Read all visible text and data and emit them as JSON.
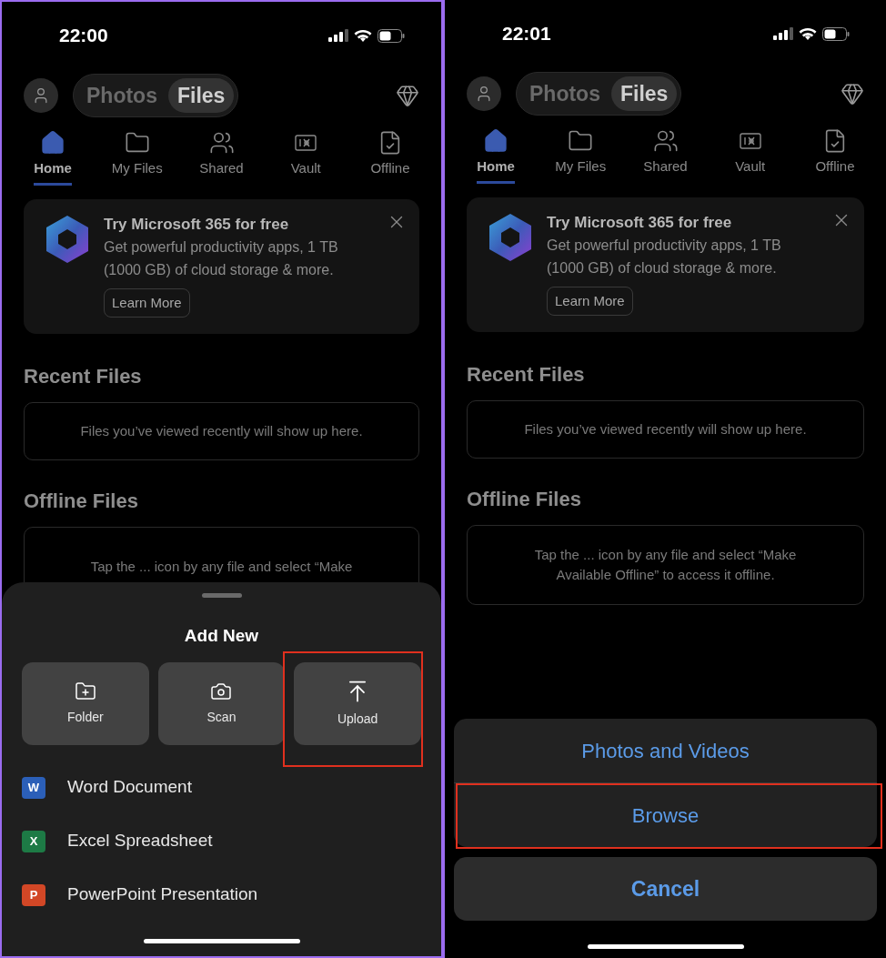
{
  "screens": [
    {
      "framed": true,
      "status_bar": {
        "time": "22:00"
      },
      "segments": [
        {
          "label": "Photos",
          "selected": false
        },
        {
          "label": "Files",
          "selected": true
        }
      ],
      "tabs": [
        {
          "label": "Home",
          "kind": "home",
          "selected": true
        },
        {
          "label": "My Files",
          "kind": "folder",
          "selected": false
        },
        {
          "label": "Shared",
          "kind": "shared",
          "selected": false
        },
        {
          "label": "Vault",
          "kind": "vault",
          "selected": false
        },
        {
          "label": "Offline",
          "kind": "offline",
          "selected": false
        }
      ],
      "promo": {
        "title": "Try Microsoft 365 for free",
        "body": "Get powerful productivity apps, 1 TB (1000 GB) of cloud storage & more.",
        "button": "Learn More"
      },
      "recent_files": {
        "heading": "Recent Files",
        "message": "Files you’ve viewed recently will show up here."
      },
      "offline_files": {
        "heading": "Offline Files",
        "message": "Tap the ... icon by any file and select “Make"
      },
      "overlay": {
        "kind": "add_new_sheet",
        "title": "Add New",
        "actions": [
          {
            "label": "Folder",
            "kind": "folder",
            "highlighted": false
          },
          {
            "label": "Scan",
            "kind": "scan",
            "highlighted": false
          },
          {
            "label": "Upload",
            "kind": "upload",
            "highlighted": true
          }
        ],
        "items": [
          {
            "label": "Word Document",
            "letter": "W",
            "color": "#2b5fb8"
          },
          {
            "label": "Excel Spreadsheet",
            "letter": "X",
            "color": "#1d7a45"
          },
          {
            "label": "PowerPoint Presentation",
            "letter": "P",
            "color": "#d24726"
          }
        ]
      }
    },
    {
      "framed": false,
      "status_bar": {
        "time": "22:01"
      },
      "segments": [
        {
          "label": "Photos",
          "selected": false
        },
        {
          "label": "Files",
          "selected": true
        }
      ],
      "tabs": [
        {
          "label": "Home",
          "kind": "home",
          "selected": true
        },
        {
          "label": "My Files",
          "kind": "folder",
          "selected": false
        },
        {
          "label": "Shared",
          "kind": "shared",
          "selected": false
        },
        {
          "label": "Vault",
          "kind": "vault",
          "selected": false
        },
        {
          "label": "Offline",
          "kind": "offline",
          "selected": false
        }
      ],
      "promo": {
        "title": "Try Microsoft 365 for free",
        "body": "Get powerful productivity apps, 1 TB (1000 GB) of cloud storage & more.",
        "button": "Learn More"
      },
      "recent_files": {
        "heading": "Recent Files",
        "message": "Files you’ve viewed recently will show up here."
      },
      "offline_files": {
        "heading": "Offline Files",
        "message": "Tap the ... icon by any file and select “Make Available Offline” to access it offline."
      },
      "overlay": {
        "kind": "action_sheet",
        "options": [
          {
            "label": "Photos and Videos",
            "highlighted": false
          },
          {
            "label": "Browse",
            "highlighted": true
          }
        ],
        "cancel": "Cancel"
      }
    }
  ]
}
